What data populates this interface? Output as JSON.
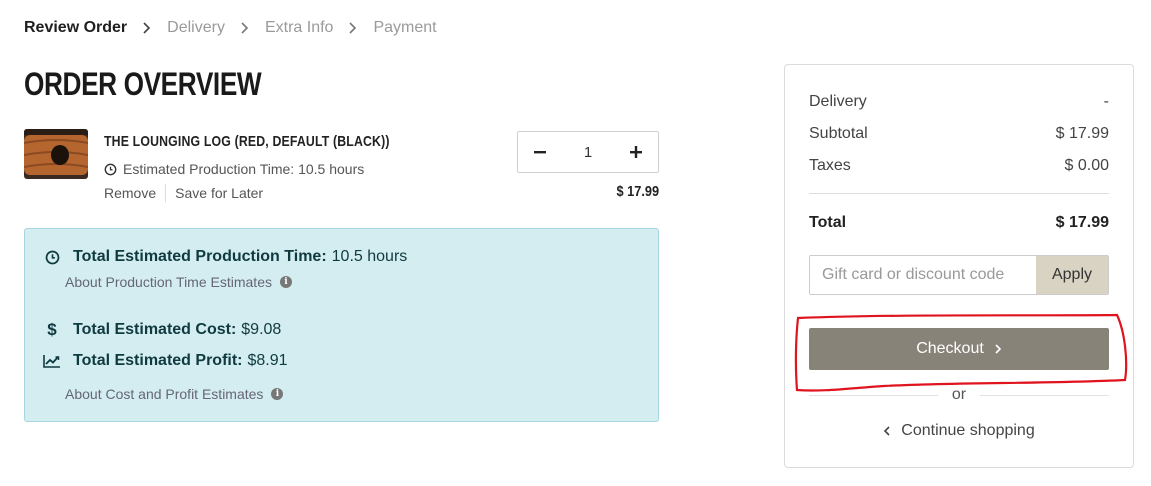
{
  "breadcrumb": {
    "items": [
      "Review Order",
      "Delivery",
      "Extra Info",
      "Payment"
    ]
  },
  "page_title": "ORDER OVERVIEW",
  "item": {
    "name": "THE LOUNGING LOG (RED, DEFAULT (BLACK))",
    "production_time": "Estimated Production Time: 10.5 hours",
    "remove_label": "Remove",
    "save_label": "Save for Later",
    "quantity": "1",
    "price": "$ 17.99"
  },
  "estimates": {
    "production_label": "Total Estimated Production Time:",
    "production_value": "10.5 hours",
    "production_link": "About Production Time Estimates",
    "cost_label": "Total Estimated Cost:",
    "cost_value": "$9.08",
    "profit_label": "Total Estimated Profit:",
    "profit_value": "$8.91",
    "cost_link": "About Cost and Profit Estimates"
  },
  "summary": {
    "delivery_label": "Delivery",
    "delivery_value": "-",
    "subtotal_label": "Subtotal",
    "subtotal_value": "$ 17.99",
    "taxes_label": "Taxes",
    "taxes_value": "$ 0.00",
    "total_label": "Total",
    "total_value": "$ 17.99",
    "discount_placeholder": "Gift card or discount code",
    "apply_label": "Apply",
    "checkout_label": "Checkout",
    "or_label": "or",
    "continue_label": "Continue shopping"
  },
  "colors": {
    "estimate_bg": "#d4edf1",
    "checkout_bg": "#888378",
    "apply_bg": "#d9d3c4",
    "annotation": "#e0141e"
  }
}
